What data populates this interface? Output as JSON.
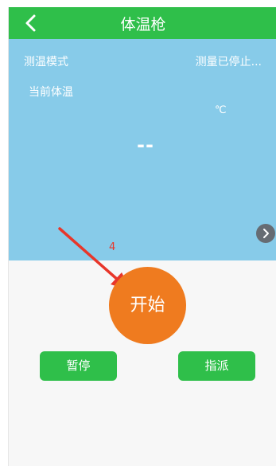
{
  "header": {
    "title": "体温枪",
    "back_icon": "chevron-left-icon"
  },
  "panel": {
    "mode_label": "测温模式",
    "status": "测量已停止...",
    "temp_label": "当前体温",
    "unit": "℃",
    "value": "--",
    "next_icon": "chevron-right-icon"
  },
  "annotation": {
    "number": "4"
  },
  "actions": {
    "start_label": "开始",
    "pause_label": "暂停",
    "assign_label": "指派"
  },
  "colors": {
    "header_green": "#2fbf4a",
    "panel_blue": "#87cbe9",
    "start_orange": "#ef7b1f",
    "annotation_red": "#e8362a"
  }
}
